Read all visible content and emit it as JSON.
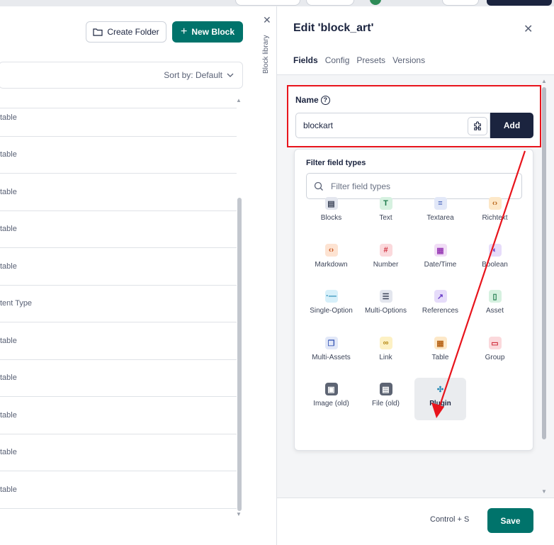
{
  "library": {
    "create_folder_label": "Create Folder",
    "new_block_label": "New Block",
    "sort_label": "Sort by: Default",
    "sidebar_label": "Block library",
    "rows": [
      "table",
      "table",
      "table",
      "table",
      "table",
      "tent Type",
      "table",
      "table",
      "table",
      "table",
      "table"
    ]
  },
  "panel": {
    "title": "Edit 'block_art'",
    "tabs": [
      "Fields",
      "Config",
      "Presets",
      "Versions"
    ],
    "name_label": "Name",
    "name_value": "blockart",
    "add_label": "Add",
    "filter_title": "Filter field types",
    "filter_placeholder": "Filter field types",
    "field_types": [
      {
        "label": "Blocks",
        "icon": "blocks-icon",
        "color": "#e3e6ee",
        "fg": "#3d4559"
      },
      {
        "label": "Text",
        "icon": "text-icon",
        "color": "#d6f1e0",
        "fg": "#1d7a4b"
      },
      {
        "label": "Textarea",
        "icon": "textarea-icon",
        "color": "#e2e8f8",
        "fg": "#3f5db7"
      },
      {
        "label": "Richtext",
        "icon": "richtext-icon",
        "color": "#fde8c8",
        "fg": "#b8661b"
      },
      {
        "label": "Markdown",
        "icon": "markdown-icon",
        "color": "#fde3d2",
        "fg": "#c9551e"
      },
      {
        "label": "Number",
        "icon": "number-icon",
        "color": "#fbd9dc",
        "fg": "#d0313f"
      },
      {
        "label": "Date/Time",
        "icon": "datetime-icon",
        "color": "#f1ddf6",
        "fg": "#9a3fb6"
      },
      {
        "label": "Boolean",
        "icon": "boolean-icon",
        "color": "#e6dcfa",
        "fg": "#6b3fc7"
      },
      {
        "label": "Single-Option",
        "icon": "single-option-icon",
        "color": "#d7f0fa",
        "fg": "#1f86b3"
      },
      {
        "label": "Multi-Options",
        "icon": "multi-options-icon",
        "color": "#e3e6ee",
        "fg": "#3d4559"
      },
      {
        "label": "References",
        "icon": "references-icon",
        "color": "#e6dcfa",
        "fg": "#6b3fc7"
      },
      {
        "label": "Asset",
        "icon": "asset-icon",
        "color": "#d6f1e0",
        "fg": "#1d7a4b"
      },
      {
        "label": "Multi-Assets",
        "icon": "multi-assets-icon",
        "color": "#e2e8f8",
        "fg": "#3f5db7"
      },
      {
        "label": "Link",
        "icon": "link-icon",
        "color": "#fdf1c4",
        "fg": "#b48712"
      },
      {
        "label": "Table",
        "icon": "table-icon",
        "color": "#fde8c8",
        "fg": "#b8661b"
      },
      {
        "label": "Group",
        "icon": "group-icon",
        "color": "#fbd9dc",
        "fg": "#d0313f"
      },
      {
        "label": "Image (old)",
        "icon": "image-icon",
        "color": "#5d6473",
        "fg": "#ffffff"
      },
      {
        "label": "File (old)",
        "icon": "file-icon",
        "color": "#5d6473",
        "fg": "#ffffff"
      },
      {
        "label": "Plugin",
        "icon": "plugin-icon",
        "color": "transparent",
        "fg": "#1f86b3"
      }
    ],
    "shortcut": "Control + S",
    "save_label": "Save"
  },
  "colors": {
    "primary": "#00736b",
    "dark": "#1b243f",
    "highlight": "#e8141c"
  }
}
